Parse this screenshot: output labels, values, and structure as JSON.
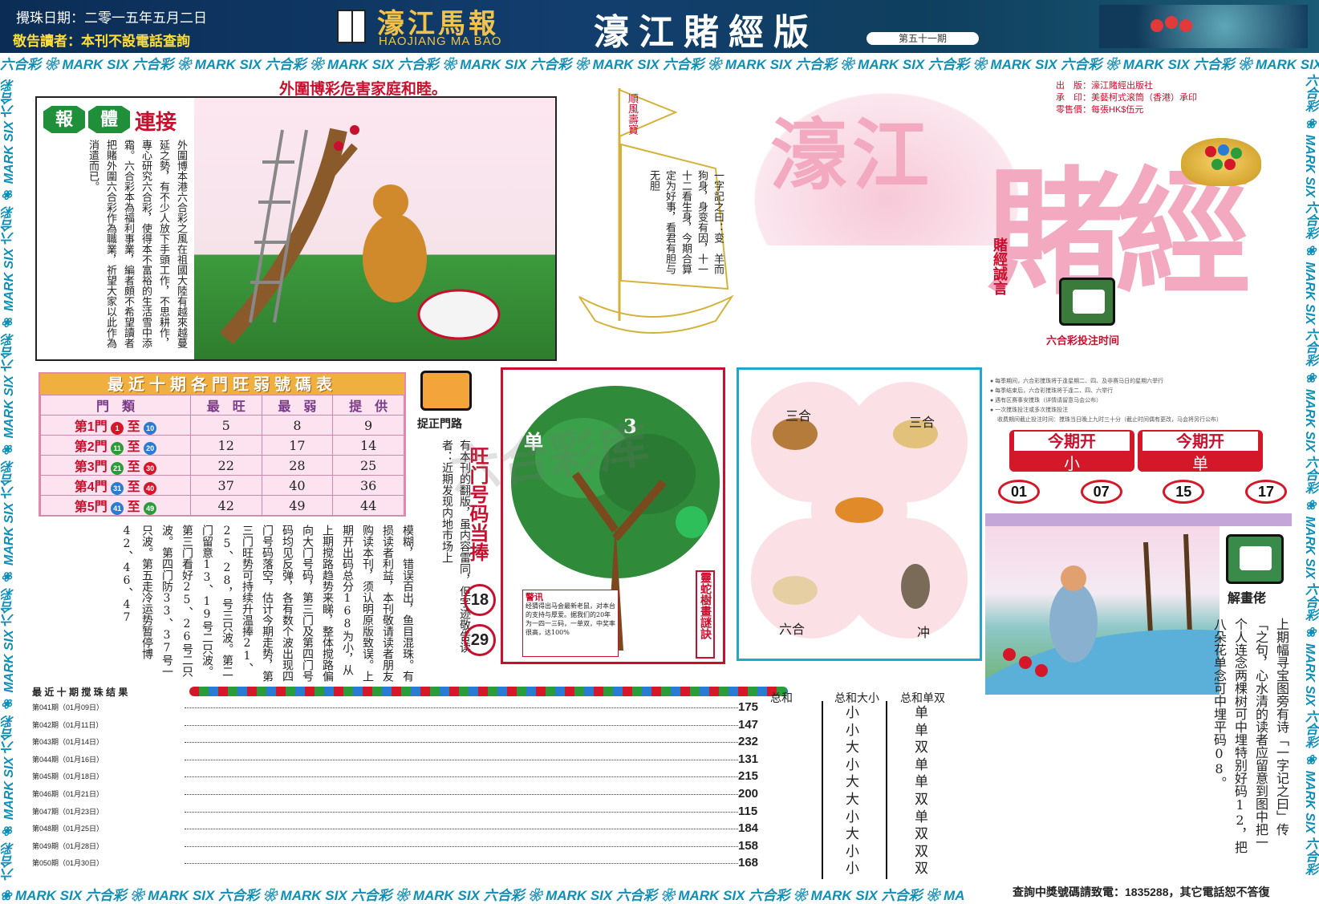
{
  "header": {
    "draw_date": "攪珠日期：二零一五年五月二日",
    "notice": "敬告讀者：本刊不設電話查詢",
    "logo_text": "濠江馬報",
    "logo_roman": "HAOJIANG MA BAO",
    "edition_title": "濠江賭經版",
    "issue": "第五十一期"
  },
  "strip_text": "六合彩 ❀ MARK SIX 六合彩 ❀ MARK SIX 六合彩 ❀ MARK SIX 六合彩 ❀ MARK SIX 六合彩 ❀ MARK SIX 六合彩 ❀ MARK SIX 六合彩 ❀ MARK SIX 六合彩 ❀ MARK SIX 六合彩 ❀ MARK SIX 六合彩 ❀ MARK SIX",
  "bottom_strip_text": "❀ MARK SIX 六合彩 ❀ MARK SIX 六合彩 ❀ MARK SIX 六合彩 ❀ MARK SIX 六合彩 ❀ MARK SIX 六合彩 ❀ MARK SIX 六合彩 ❀ MARK SIX 六合彩 ❀ MA",
  "footer_hotline": "查詢中獎號碼請致電：1835288，其它電話恕不答復",
  "headline": "外圍博彩危害家庭和睦。",
  "article": {
    "badge1": "報",
    "badge2": "體",
    "badge3": "連接",
    "body": "外圍博本港六合彩之風在祖國大陸有越來越蔓延之勢，有不少人放下手頭工作，不思耕作，專心研究六合彩，使得本不富裕的生活雪中添霜。六合彩本為福利事業，編者頗不希望讀者把賭外圍六合彩作為職業，祈望大家以此作為消遣而已。"
  },
  "sail": {
    "flag": "順風壽寶",
    "poem": "一字記之曰：变　羊而狗身，身变有因，十一十二看生身，今期合算定为好事，看君有胆与无胆"
  },
  "masthead": {
    "publisher_label": "出　版：",
    "publisher": "濠江賭經出版社",
    "printer_label": "承　印：",
    "printer": "美藝柯式滚筒（香港）承印",
    "price_label": "零售價：",
    "price": "每張HK$伍元",
    "big_title_1": "濠江",
    "big_title_2": "賭經",
    "motto": "賭經誠言",
    "schedule_title": "六合彩投注时间",
    "schedule_lines": [
      "● 每季期间，六合彩搅珠将于逢星期二、四、及非赛马日的星期六举行",
      "● 每季结束后，六合彩搅珠将于逢二、四、六举行",
      "● 遇有区赛事安搅珠（详情请留意马会公布）",
      "● 一次搅珠投注或多次搅珠投注",
      "　 收费期间截止投注时间：搅珠当日晚上九时三十分（截止时间偶有更改，马会将另行公布）"
    ]
  },
  "stats_table": {
    "title": "最近十期各門旺弱號碼表",
    "headers": [
      "門　類",
      "最　旺",
      "最　弱",
      "提　供"
    ],
    "rows": [
      {
        "door": "第1門",
        "from": "1",
        "to": "10",
        "hot": "5",
        "cold": "8",
        "tip": "9"
      },
      {
        "door": "第2門",
        "from": "11",
        "to": "20",
        "hot": "12",
        "cold": "17",
        "tip": "14"
      },
      {
        "door": "第3門",
        "from": "21",
        "to": "30",
        "hot": "22",
        "cold": "28",
        "tip": "25"
      },
      {
        "door": "第4門",
        "from": "31",
        "to": "40",
        "hot": "37",
        "cold": "40",
        "tip": "36"
      },
      {
        "door": "第5門",
        "from": "41",
        "to": "49",
        "hot": "42",
        "cold": "49",
        "tip": "44"
      }
    ],
    "connector": "至"
  },
  "door_road": {
    "title": "捉正門路",
    "notice": "有本刊的翻版，虽内容雷同，但字迹敬告读者：近期发现内地市场上",
    "heading": "旺门号码当捧",
    "numbers": [
      "18",
      "29"
    ],
    "body": "模糊，错误百出，鱼目混珠。有损读者利益，本刊敬请读者朋友购读本刊，须认明原版致误。上期开出码总分168为小，从上期搅路趋势来睇，整体搅路偏向大门号码，第三门及第四门号码均见反弹，各有数个波出现四门号码落空，估计今期走势，第三门旺势可持续升温捧21、25、28，号三只波。第二门留意13、19号二只波。第三门看好25、26号二只波。第四门防33、37号一只波。第五走冷运势暂停博42、46、47"
  },
  "tree": {
    "label_single": "单",
    "label_three": "3",
    "side_title": "靈蛇樹畫謎訣",
    "note_title": "警讯",
    "note": "经猜得出马会最新老鼠，对本台的支持与厚爱。据我们的20年为一四一三码，一单双，中奖率很高，达100%"
  },
  "butterfly": {
    "tl": "三合",
    "tr": "三合",
    "bl": "六合",
    "br": "冲"
  },
  "today": {
    "label1": "今期开",
    "value1": "小",
    "label2": "今期开",
    "value2": "单",
    "picks": [
      "01",
      "07",
      "15",
      "17"
    ]
  },
  "riddle": {
    "title": "解畫佬",
    "text": "上期幅寻宝图旁有诗「一字记之曰」传「之句，心水清的读者应留意到图中把一个人连念两棵树可中埋特别好码12，把八朵花单念可中埋平码08。"
  },
  "results": {
    "title": "最 近 十 期 搅 珠 结 果",
    "col_sum": "总和",
    "col_size": "总和大小",
    "col_odd": "总和单双",
    "rows": [
      {
        "period": "第041期（01月09日）",
        "sum": "175",
        "size": "小",
        "odd": "单"
      },
      {
        "period": "第042期（01月11日）",
        "sum": "147",
        "size": "小",
        "odd": "单"
      },
      {
        "period": "第043期（01月14日）",
        "sum": "232",
        "size": "大",
        "odd": "双"
      },
      {
        "period": "第044期（01月16日）",
        "sum": "131",
        "size": "小",
        "odd": "单"
      },
      {
        "period": "第045期（01月18日）",
        "sum": "215",
        "size": "大",
        "odd": "单"
      },
      {
        "period": "第046期（01月21日）",
        "sum": "200",
        "size": "大",
        "odd": "双"
      },
      {
        "period": "第047期（01月23日）",
        "sum": "115",
        "size": "小",
        "odd": "单"
      },
      {
        "period": "第048期（01月25日）",
        "sum": "184",
        "size": "大",
        "odd": "双"
      },
      {
        "period": "第049期（01月28日）",
        "sum": "158",
        "size": "小",
        "odd": "双"
      },
      {
        "period": "第050期（01月30日）",
        "sum": "168",
        "size": "小",
        "odd": "双"
      }
    ]
  },
  "watermark": "六合彩库",
  "colors": {
    "red": "#d4182a",
    "blue": "#0e8fb8",
    "pink": "#f7c9d8",
    "navy": "#123e6e"
  }
}
